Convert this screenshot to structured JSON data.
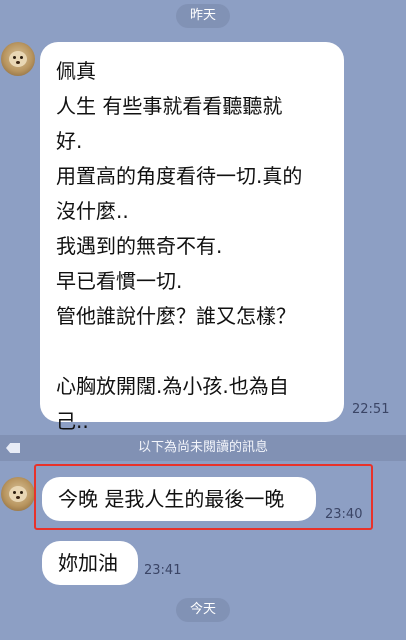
{
  "date_labels": {
    "yesterday": "昨天",
    "today": "今天"
  },
  "messages": [
    {
      "lines": [
        "佩真",
        "人生 有些事就看看聽聽就",
        "好.",
        "用置高的角度看待一切.真的",
        "沒什麼..",
        "我遇到的無奇不有.",
        "早已看慣一切.",
        "管他誰說什麼？誰又怎樣？",
        "",
        "心胸放開闊.為小孩.也為自",
        "己.."
      ],
      "time": "22:51"
    },
    {
      "text": "今晚 是我人生的最後一晚",
      "time": "23:40"
    },
    {
      "text": "妳加油",
      "time": "23:41"
    }
  ],
  "unread_divider": "以下為尚未閱讀的訊息",
  "highlight_color": "#e8322a",
  "background_color": "#8d9fc4"
}
